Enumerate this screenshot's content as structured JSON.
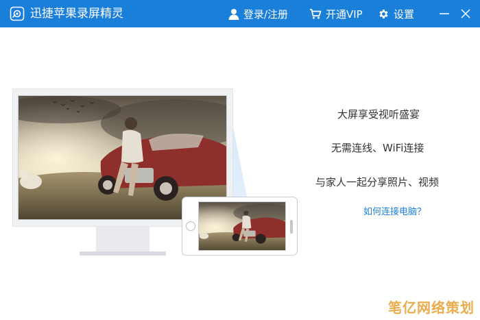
{
  "titlebar": {
    "app_title": "迅捷苹果录屏精灵",
    "login_label": "登录/注册",
    "vip_label": "开通VIP",
    "settings_label": "设置",
    "bg_color": "#1a7fd9"
  },
  "icons": {
    "logo": "screen-recorder-logo-icon",
    "login": "user-icon",
    "vip": "cart-icon",
    "settings": "gear-icon",
    "minimize": "minimize-icon",
    "close": "close-icon"
  },
  "features": {
    "line1": "大屏享受视听盛宴",
    "line2": "无需连线、WiFi连接",
    "line3": "与家人一起分享照片、视频"
  },
  "help_link": "如何连接电脑？",
  "watermark": "笔亿网络策划"
}
